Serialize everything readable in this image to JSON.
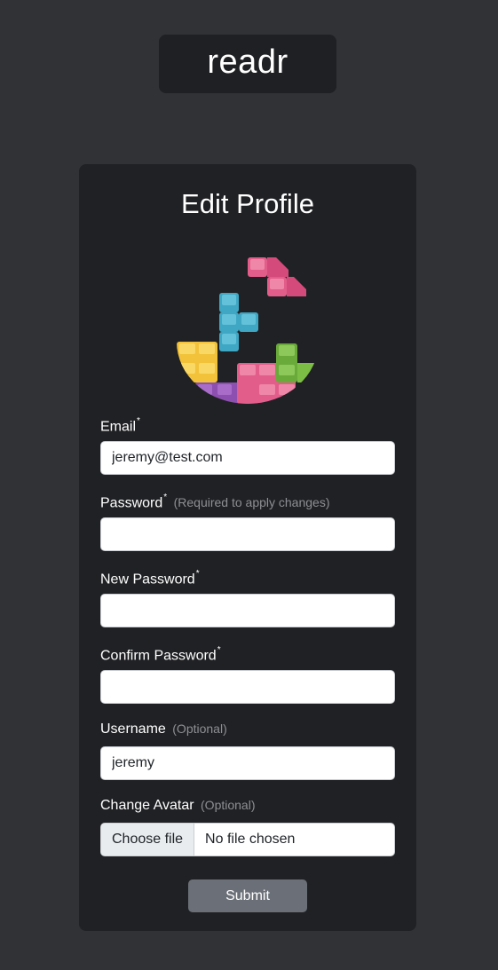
{
  "brand": {
    "name": "readr"
  },
  "form": {
    "title": "Edit Profile",
    "fields": {
      "email": {
        "label": "Email",
        "required_mark": "*",
        "value": "jeremy@test.com"
      },
      "password": {
        "label": "Password",
        "required_mark": "*",
        "hint": "(Required to apply changes)",
        "value": ""
      },
      "new_password": {
        "label": "New Password",
        "required_mark": "*",
        "value": ""
      },
      "confirm_password": {
        "label": "Confirm Password",
        "required_mark": "*",
        "value": ""
      },
      "username": {
        "label": "Username",
        "hint": "(Optional)",
        "value": "jeremy"
      },
      "avatar": {
        "label": "Change Avatar",
        "hint": "(Optional)",
        "button_label": "Choose file",
        "status": "No file chosen"
      }
    },
    "submit_label": "Submit"
  },
  "avatar_image": {
    "icon": "tetris-blocks-avatar-icon"
  },
  "colors": {
    "page_background": "#313235",
    "card_background": "#202124",
    "submit_button": "#6b7078",
    "hint_text": "#8d8f94"
  }
}
